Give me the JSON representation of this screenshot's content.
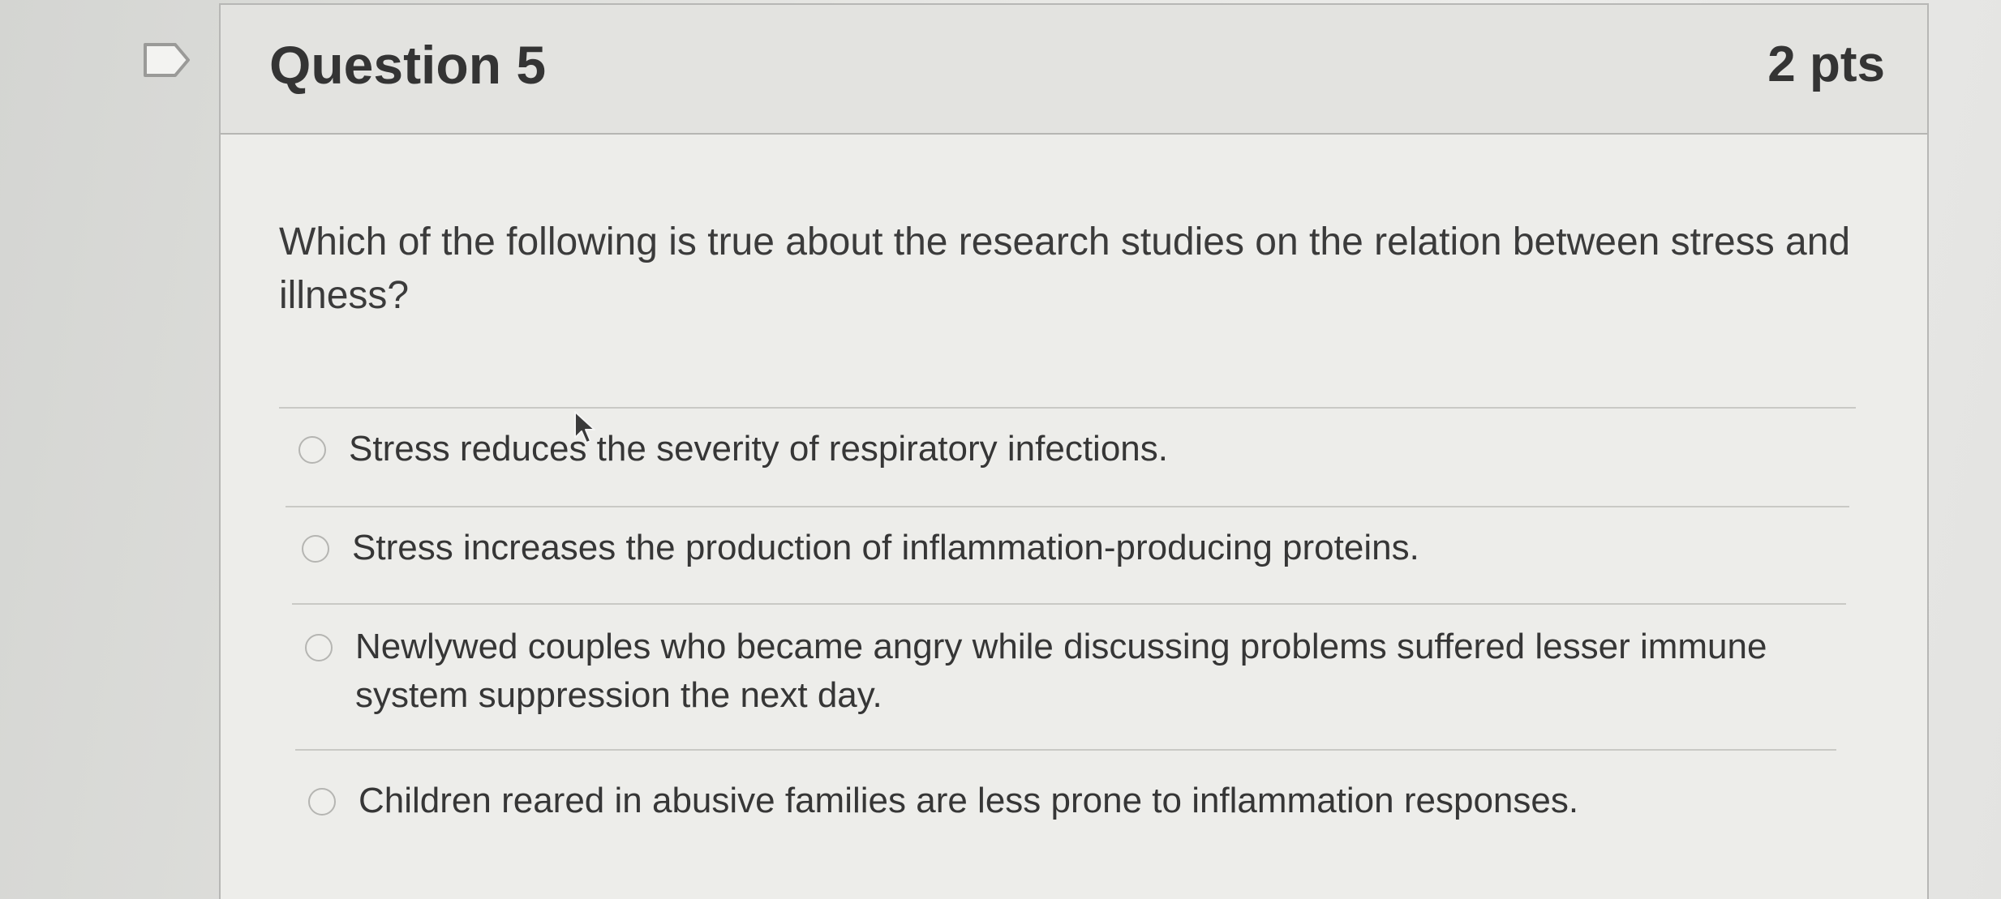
{
  "question": {
    "title": "Question 5",
    "points": "2 pts",
    "text": "Which of the following is true about the research studies on the relation between stress and illness?"
  },
  "options": [
    {
      "label": "Stress reduces the severity of respiratory infections."
    },
    {
      "label": "Stress increases the production of inflammation-producing proteins."
    },
    {
      "label": "Newlywed couples who became angry while discussing problems suffered lesser immune system suppression the next day."
    },
    {
      "label": "Children reared in abusive families are less prone to inflammation responses."
    }
  ],
  "colors": {
    "text": "#363636",
    "border": "#b7b7b5",
    "background": "#ecece9"
  },
  "icons": {
    "flag": "flag-icon",
    "cursor": "mouse-cursor-icon"
  }
}
